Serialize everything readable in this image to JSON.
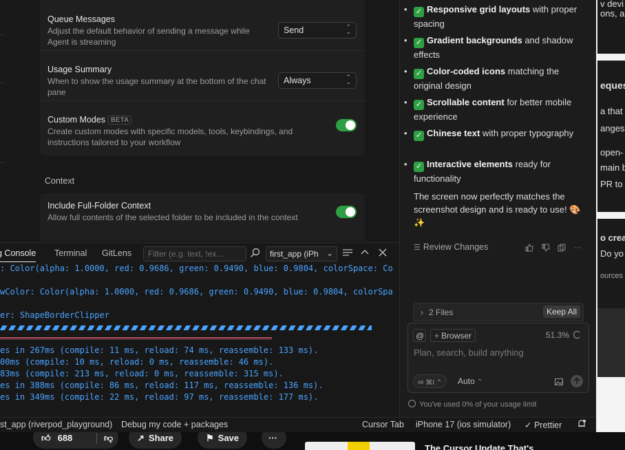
{
  "settings": {
    "queue": {
      "title": "Queue Messages",
      "desc": "Adjust the default behavior of sending a message while Agent is streaming",
      "value": "Send"
    },
    "usage": {
      "title": "Usage Summary",
      "desc": "When to show the usage summary at the bottom of the chat pane",
      "value": "Always"
    },
    "custom_modes": {
      "title": "Custom Modes",
      "badge": "BETA",
      "desc": "Create custom modes with specific models, tools, keybindings, and instructions tailored to your workflow",
      "enabled": true
    },
    "context_section": "Context",
    "full_folder": {
      "title": "Include Full-Folder Context",
      "desc": "Allow full contents of the selected folder to be included in the context",
      "enabled": true
    }
  },
  "console": {
    "tabs": [
      "g Console",
      "Terminal",
      "GitLens"
    ],
    "filter_placeholder": "Filter (e.g. text, !ex...",
    "device_select": "first_app (iPh",
    "lines": [
      ": Color(alpha: 1.0000, red: 0.9686, green: 0.9490, blue: 0.9804, colorSpace: Co",
      "wColor: Color(alpha: 1.0000, red: 0.9686, green: 0.9490, blue: 0.9804, colorSpa",
      "er: ShapeBorderClipper",
      "es in 267ms (compile: 11 ms, reload: 74 ms, reassemble: 133 ms).",
      "00ms (compile: 10 ms, reload: 0 ms, reassemble: 46 ms).",
      "83ms (compile: 213 ms, reload: 0 ms, reassemble: 315 ms).",
      "es in 388ms (compile: 86 ms, reload: 117 ms, reassemble: 136 ms).",
      "es in 349ms (compile: 22 ms, reload: 97 ms, reassemble: 177 ms)."
    ]
  },
  "chat": {
    "bullets": [
      {
        "bold": "Responsive grid layouts",
        "rest": " with proper spacing"
      },
      {
        "bold": "Gradient backgrounds",
        "rest": " and shadow effects"
      },
      {
        "bold": "Color-coded icons",
        "rest": " matching the original design"
      },
      {
        "bold": "Scrollable content",
        "rest": " for better mobile experience"
      },
      {
        "bold": "Chinese text",
        "rest": " with proper typography"
      },
      {
        "bold": "Interactive elements",
        "rest": " ready for functionality"
      }
    ],
    "summary": "The screen now perfectly matches the screenshot design and is ready to use! 🎨✨",
    "review_label": "Review Changes",
    "files_label": "2 Files",
    "keep_all": "Keep All",
    "composer": {
      "at": "@",
      "browser": "Browser",
      "percent": "51.3%",
      "placeholder": "Plan, search, build anything",
      "shortcut": "⌘I",
      "mode": "Auto"
    },
    "usage_note": "You've used 0% of your usage limit"
  },
  "right_bg": {
    "lines": [
      "v devi",
      "ons, an",
      "eques",
      "a that",
      "anges.",
      "open-",
      "main b",
      "PR to",
      "o crea",
      "Do yo",
      "ources"
    ]
  },
  "status": {
    "project": "st_app (riverpod_playground)",
    "debug": "Debug my code + packages",
    "cursor_tab": "Cursor Tab",
    "device": "iPhone 17 (ios simulator)",
    "prettier": "✓ Prettier"
  },
  "bottom": {
    "likes": "688",
    "share": "Share",
    "save": "Save",
    "more": "···",
    "video_title": "The Cursor Update That's"
  },
  "colors": {
    "accent_green": "#2ea043",
    "log_blue": "#4aa3ff",
    "log_red": "#e0607e"
  }
}
